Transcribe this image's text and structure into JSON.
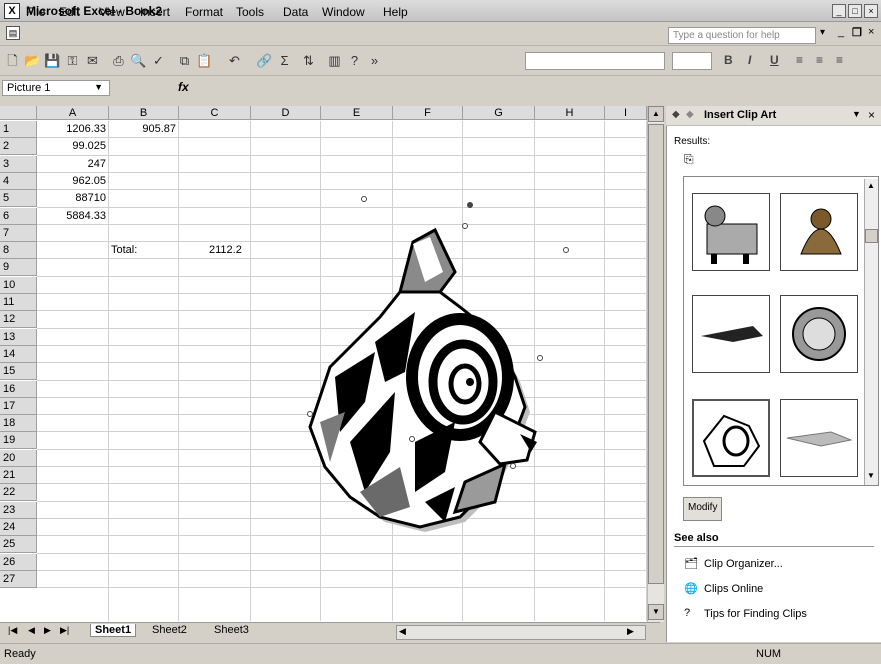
{
  "window": {
    "title": "Microsoft Excel - Book2",
    "app_icon": "excel-icon"
  },
  "menu": [
    {
      "label": "File",
      "u": "F"
    },
    {
      "label": "Edit",
      "u": "E"
    },
    {
      "label": "View",
      "u": "V"
    },
    {
      "label": "Insert",
      "u": "I"
    },
    {
      "label": "Format",
      "u": "o"
    },
    {
      "label": "Tools",
      "u": "T"
    },
    {
      "label": "Data",
      "u": "D"
    },
    {
      "label": "Window",
      "u": "W"
    },
    {
      "label": "Help",
      "u": "H"
    }
  ],
  "help_placeholder": "Type a question for help",
  "formula": {
    "name_box": "Picture 1",
    "fx": "fx"
  },
  "columns": [
    "A",
    "B",
    "C",
    "D",
    "E",
    "F",
    "G",
    "H",
    "I"
  ],
  "rows": [
    "1",
    "2",
    "3",
    "4",
    "5",
    "6",
    "7",
    "8",
    "9",
    "10",
    "11",
    "12",
    "13",
    "14",
    "15",
    "16",
    "17",
    "18",
    "19",
    "20",
    "21",
    "22",
    "23",
    "24",
    "25",
    "26",
    "27"
  ],
  "cells": {
    "A1": "1206.33",
    "B1": "905.87",
    "A2": "99.025",
    "A3": "247",
    "A4": "962.05",
    "A5": "88710",
    "A6": "5884.33",
    "B8": "Total:",
    "C8": "2112.2"
  },
  "sheet_tabs": [
    "Sheet1",
    "Sheet2",
    "Sheet3"
  ],
  "active_sheet": "Sheet1",
  "status": {
    "left": "Ready",
    "num": "NUM"
  },
  "task_pane": {
    "title": "Insert Clip Art",
    "results_label": "Results:",
    "modify_button": "Modify",
    "see_also_heading": "See also",
    "links": [
      "Clip Organizer...",
      "Clips Online",
      "Tips for Finding Clips"
    ]
  },
  "colors": {
    "pane_header": "#e2dfd8",
    "grid_header": "#dcdcdc"
  }
}
